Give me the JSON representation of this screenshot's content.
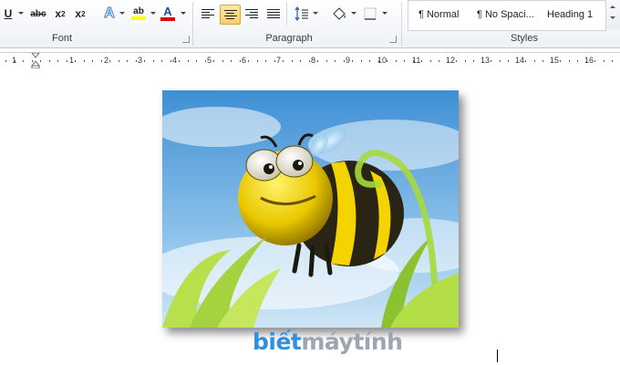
{
  "ribbon": {
    "font_group": {
      "label": "Font",
      "underline": "U",
      "strikethrough": "abc",
      "subscript": "x",
      "subscript_mark": "2",
      "superscript": "x",
      "superscript_mark": "2",
      "text_effects": "A",
      "highlight": "ab",
      "font_color": "A",
      "highlight_color": "#ffff00",
      "font_color_value": "#e00000"
    },
    "paragraph_group": {
      "label": "Paragraph",
      "active_alignment": "center"
    },
    "styles_group": {
      "label": "Styles",
      "items": [
        "¶ Normal",
        "¶ No Spaci...",
        "Heading 1"
      ]
    }
  },
  "ruler": {
    "left_numbers": [
      "1"
    ],
    "numbers": [
      "1",
      "2",
      "3",
      "4",
      "5",
      "6",
      "7",
      "8",
      "9",
      "10",
      "11",
      "12",
      "13",
      "14",
      "15",
      "16"
    ]
  },
  "document": {
    "image_subject": "cartoon-bee-in-grass",
    "watermark_part1": "biết",
    "watermark_part2": "máytính"
  }
}
